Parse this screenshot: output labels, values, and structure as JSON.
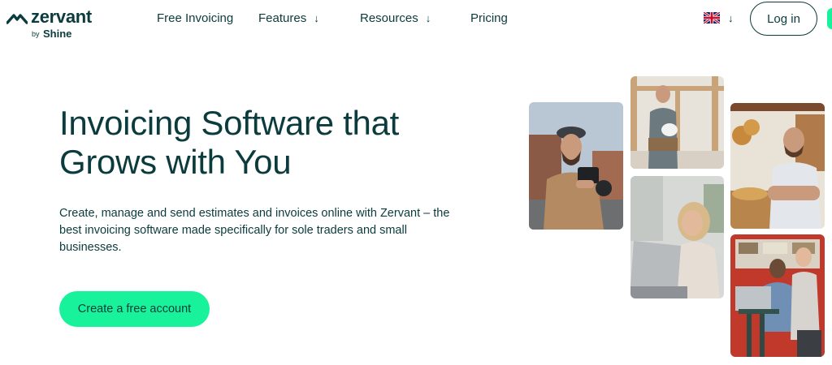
{
  "brand": {
    "name": "zervant",
    "by": "by",
    "parent": "Shine"
  },
  "nav": {
    "items": [
      {
        "label": "Free Invoicing",
        "has_dropdown": false
      },
      {
        "label": "Features",
        "has_dropdown": true
      },
      {
        "label": "Resources",
        "has_dropdown": true
      },
      {
        "label": "Pricing",
        "has_dropdown": false
      }
    ],
    "login_label": "Log in"
  },
  "language": {
    "icon": "uk-flag-icon"
  },
  "hero": {
    "title": "Invoicing Software that Grows with You",
    "description": "Create, manage and send estimates and invoices online with Zervant – the best invoicing software made specifically for sole traders and small businesses.",
    "cta_label": "Create a free account"
  },
  "photos": [
    {
      "subject": "photographer-with-camera"
    },
    {
      "subject": "builder-with-hard-hat"
    },
    {
      "subject": "woman-with-laptop"
    },
    {
      "subject": "baker-in-bakery"
    },
    {
      "subject": "people-in-cafe"
    }
  ],
  "colors": {
    "primary_text": "#0b3b3c",
    "accent": "#18f39b",
    "background": "#ffffff"
  }
}
